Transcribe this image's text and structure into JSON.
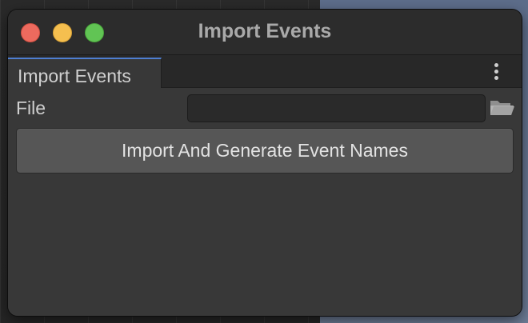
{
  "window": {
    "title": "Import Events"
  },
  "tabs": [
    {
      "label": "Import Events",
      "active": true
    }
  ],
  "form": {
    "file_label": "File",
    "file_value": "",
    "import_button_label": "Import And Generate Event Names"
  },
  "icons": {
    "tab_menu": "kebab-menu-icon",
    "browse": "folder-icon"
  },
  "colors": {
    "close": "#ed6a5e",
    "minimize": "#f5bf4f",
    "maximize": "#61c454",
    "active_tab_accent": "#4e7ed1"
  }
}
